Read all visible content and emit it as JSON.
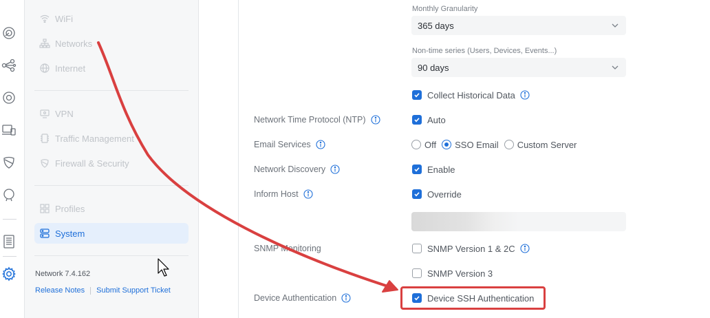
{
  "rail": {
    "icons": [
      "dashboard-icon",
      "topology-icon",
      "devices-icon",
      "clients-icon",
      "protect-icon",
      "insights-icon",
      "logs-icon",
      "settings-icon"
    ]
  },
  "nav": {
    "items": [
      {
        "label": "WiFi",
        "icon": "wifi-icon"
      },
      {
        "label": "Networks",
        "icon": "networks-icon"
      },
      {
        "label": "Internet",
        "icon": "globe-icon"
      },
      {
        "label": "VPN",
        "icon": "vpn-icon"
      },
      {
        "label": "Traffic Management",
        "icon": "traffic-icon"
      },
      {
        "label": "Firewall & Security",
        "icon": "shield-icon"
      },
      {
        "label": "Profiles",
        "icon": "profiles-icon"
      },
      {
        "label": "System",
        "icon": "system-icon",
        "active": true
      }
    ],
    "version": "Network 7.4.162",
    "release_notes": "Release Notes",
    "support_ticket": "Submit Support Ticket"
  },
  "main": {
    "monthly_granularity": {
      "label": "Monthly Granularity",
      "value": "365 days"
    },
    "non_time_series": {
      "label": "Non-time series (Users, Devices, Events...)",
      "value": "90 days"
    },
    "collect_historical": {
      "label": "Collect Historical Data",
      "checked": true
    },
    "ntp": {
      "label": "Network Time Protocol (NTP)",
      "option": "Auto",
      "checked": true
    },
    "email_services": {
      "label": "Email Services",
      "options": [
        "Off",
        "SSO Email",
        "Custom Server"
      ],
      "selected": "SSO Email"
    },
    "network_discovery": {
      "label": "Network Discovery",
      "option": "Enable",
      "checked": true
    },
    "inform_host": {
      "label": "Inform Host",
      "option": "Override",
      "checked": true
    },
    "snmp": {
      "label": "SNMP Monitoring",
      "v1": {
        "label": "SNMP Version 1 & 2C",
        "checked": false
      },
      "v3": {
        "label": "SNMP Version 3",
        "checked": false
      }
    },
    "device_auth": {
      "label": "Device Authentication",
      "option": "Device SSH Authentication",
      "checked": true
    }
  },
  "colors": {
    "accent": "#1e6fd9",
    "annotation": "#d94040",
    "nav_bg": "#f6f7f8"
  }
}
